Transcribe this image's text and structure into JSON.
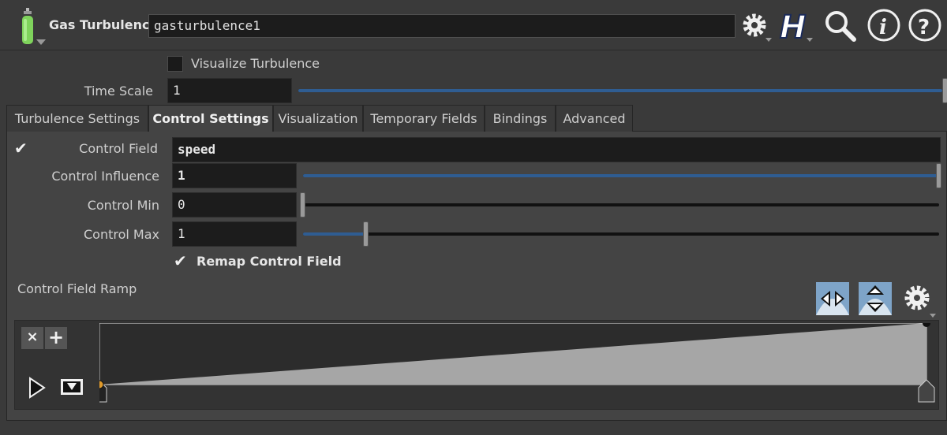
{
  "header": {
    "node_type": "Gas Turbulence",
    "node_name": "gasturbulence1",
    "icons": [
      "gas-cylinder-icon",
      "gear-icon",
      "houdini-h-icon",
      "magnifier-icon",
      "info-icon",
      "help-icon"
    ]
  },
  "params": {
    "visualize_turbulence": {
      "label": "Visualize Turbulence",
      "checked": false
    },
    "time_scale": {
      "label": "Time Scale",
      "value": "1",
      "slider_fraction": 1.0
    }
  },
  "tabs": [
    {
      "label": "Turbulence Settings",
      "active": false
    },
    {
      "label": "Control Settings",
      "active": true
    },
    {
      "label": "Visualization",
      "active": false
    },
    {
      "label": "Temporary Fields",
      "active": false
    },
    {
      "label": "Bindings",
      "active": false
    },
    {
      "label": "Advanced",
      "active": false
    }
  ],
  "control": {
    "control_field": {
      "label": "Control Field",
      "value": "speed",
      "enabled": true
    },
    "control_influence": {
      "label": "Control Influence",
      "value": "1",
      "slider_fraction": 1.0
    },
    "control_min": {
      "label": "Control Min",
      "value": "0",
      "slider_fraction": 0.0
    },
    "control_max": {
      "label": "Control Max",
      "value": "1",
      "slider_fraction": 0.1
    },
    "remap": {
      "label": "Remap Control Field",
      "checked": true
    },
    "ramp_label": "Control Field Ramp"
  },
  "ramp": {
    "points": [
      {
        "pos": 0.0,
        "value": 0.0
      },
      {
        "pos": 1.0,
        "value": 1.0
      }
    ],
    "fill_color": "#a6a6a6",
    "bg_color": "#2c2c2c",
    "selected_key_color": "#e09a2a"
  },
  "colors": {
    "accent": "#2f5d92"
  }
}
